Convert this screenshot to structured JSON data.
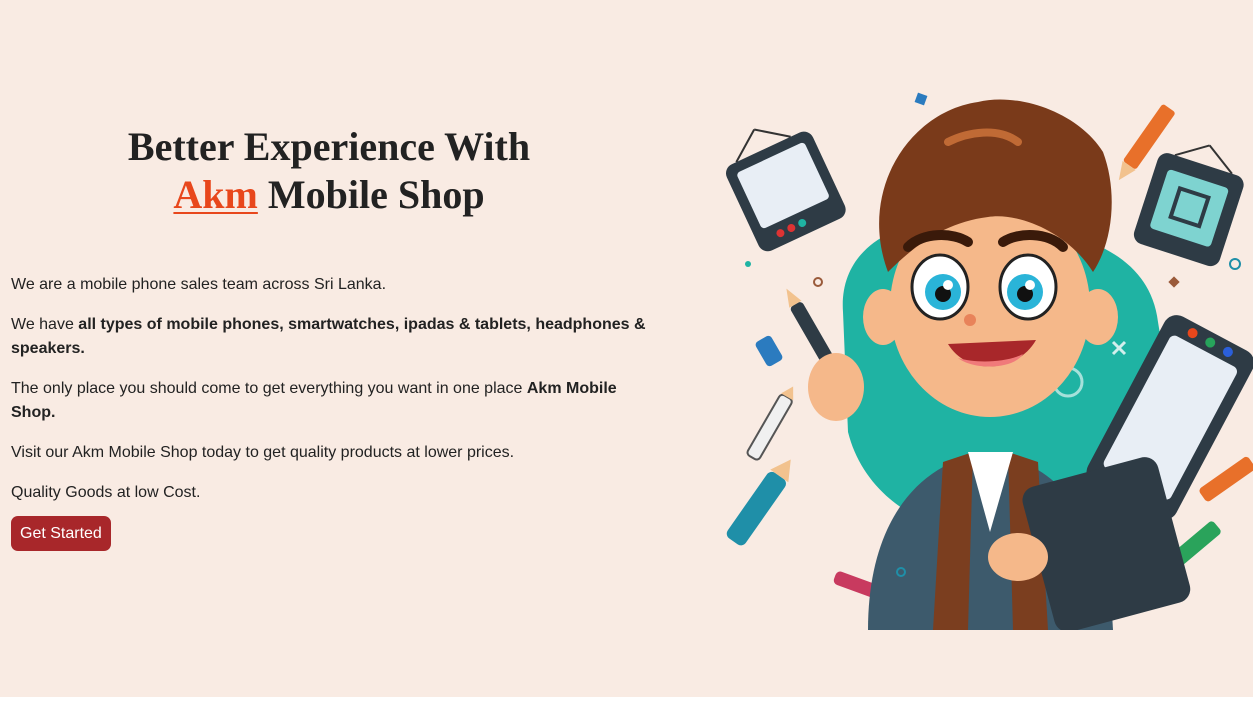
{
  "hero": {
    "headline_line1": "Better Experience With",
    "brand": "Akm",
    "headline_rest": " Mobile Shop",
    "paragraph1": "We are a mobile phone sales team across Sri Lanka.",
    "paragraph2_prefix": "We have ",
    "paragraph2_bold": "all types of mobile phones, smartwatches, ipadas & tablets, headphones & speakers.",
    "paragraph3_prefix": "The only place you should come to get everything you want in one place ",
    "paragraph3_bold": "Akm Mobile Shop.",
    "paragraph4": "Visit our Akm Mobile Shop today to get quality products at lower prices.",
    "paragraph5": "Quality Goods at low Cost.",
    "cta_label": "Get Started"
  },
  "colors": {
    "background": "#f9ebe3",
    "brand_accent": "#e8471c",
    "button": "#a8272a",
    "text": "#222222"
  },
  "illustration": {
    "icon": "cartoon-boy-with-tablet-and-pencils"
  }
}
